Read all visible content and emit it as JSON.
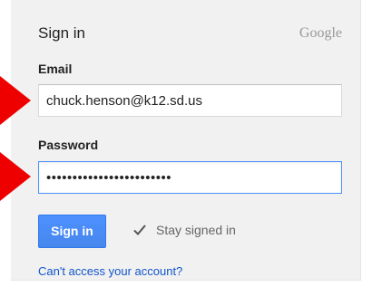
{
  "card": {
    "title": "Sign in",
    "brand": "Google"
  },
  "email": {
    "label": "Email",
    "value": "chuck.henson@k12.sd.us"
  },
  "password": {
    "label": "Password",
    "value": "••••••••••••••••••••••••"
  },
  "actions": {
    "signin_label": "Sign in",
    "stay_signed_in_label": "Stay signed in",
    "stay_signed_in_checked": true,
    "help_link": "Can't access your account?"
  },
  "icons": {
    "checkbox": "checkmark-icon",
    "annotation_arrows": "arrow-right-icon"
  },
  "colors": {
    "primary_button": "#4d90fe",
    "focus_border": "#4d90fe",
    "link": "#1155cc",
    "annotation_arrow": "#ee0000",
    "card_background": "#f1f1f1"
  }
}
